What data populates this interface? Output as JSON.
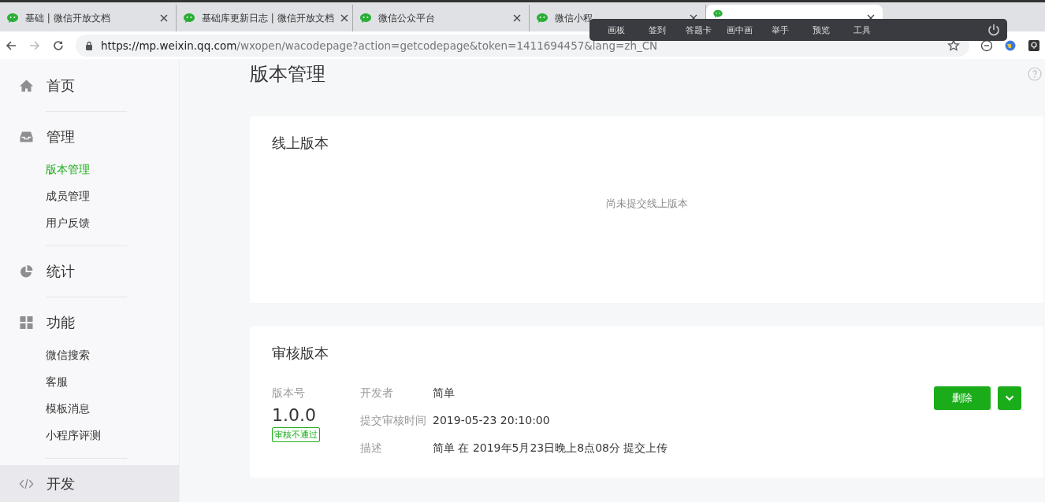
{
  "browser": {
    "tabs": [
      {
        "label": "基础 | 微信开放文档",
        "selected": false
      },
      {
        "label": "基础库更新日志 | 微信开放文档",
        "selected": false
      },
      {
        "label": "微信公众平台",
        "selected": false
      },
      {
        "label": "微信小程",
        "selected": false
      },
      {
        "selected": true
      }
    ],
    "url_host": "https://mp.weixin.qq.com",
    "url_path": "/wxopen/wacodepage?action=getcodepage&token=1411694457&lang=zh_CN"
  },
  "overlay_toolbar": {
    "items": [
      "画板",
      "签到",
      "答题卡",
      "画中画",
      "举手",
      "预览",
      "工具"
    ]
  },
  "sidebar": {
    "groups": [
      {
        "title": "首页",
        "highlighted": false
      },
      {
        "title": "管理",
        "highlighted": false,
        "items": [
          {
            "label": "版本管理",
            "selected": true
          },
          {
            "label": "成员管理",
            "selected": false
          },
          {
            "label": "用户反馈",
            "selected": false
          }
        ]
      },
      {
        "title": "统计",
        "highlighted": false
      },
      {
        "title": "功能",
        "highlighted": false,
        "items": [
          {
            "label": "微信搜索",
            "selected": false
          },
          {
            "label": "客服",
            "selected": false
          },
          {
            "label": "模板消息",
            "selected": false
          },
          {
            "label": "小程序评测",
            "selected": false
          }
        ]
      },
      {
        "title": "开发",
        "highlighted": true
      }
    ]
  },
  "page": {
    "title": "版本管理",
    "online_card": {
      "title": "线上版本",
      "empty_text": "尚未提交线上版本"
    },
    "review_card": {
      "title": "审核版本",
      "version_label": "版本号",
      "version": "1.0.0",
      "status": "审核不通过",
      "details": [
        {
          "label": "开发者",
          "value": "简单"
        },
        {
          "label": "提交审核时间",
          "value": "2019-05-23 20:10:00"
        },
        {
          "label": "描述",
          "value": "简单 在 2019年5月23日晚上8点08分 提交上传"
        }
      ],
      "delete_button": "删除"
    }
  }
}
